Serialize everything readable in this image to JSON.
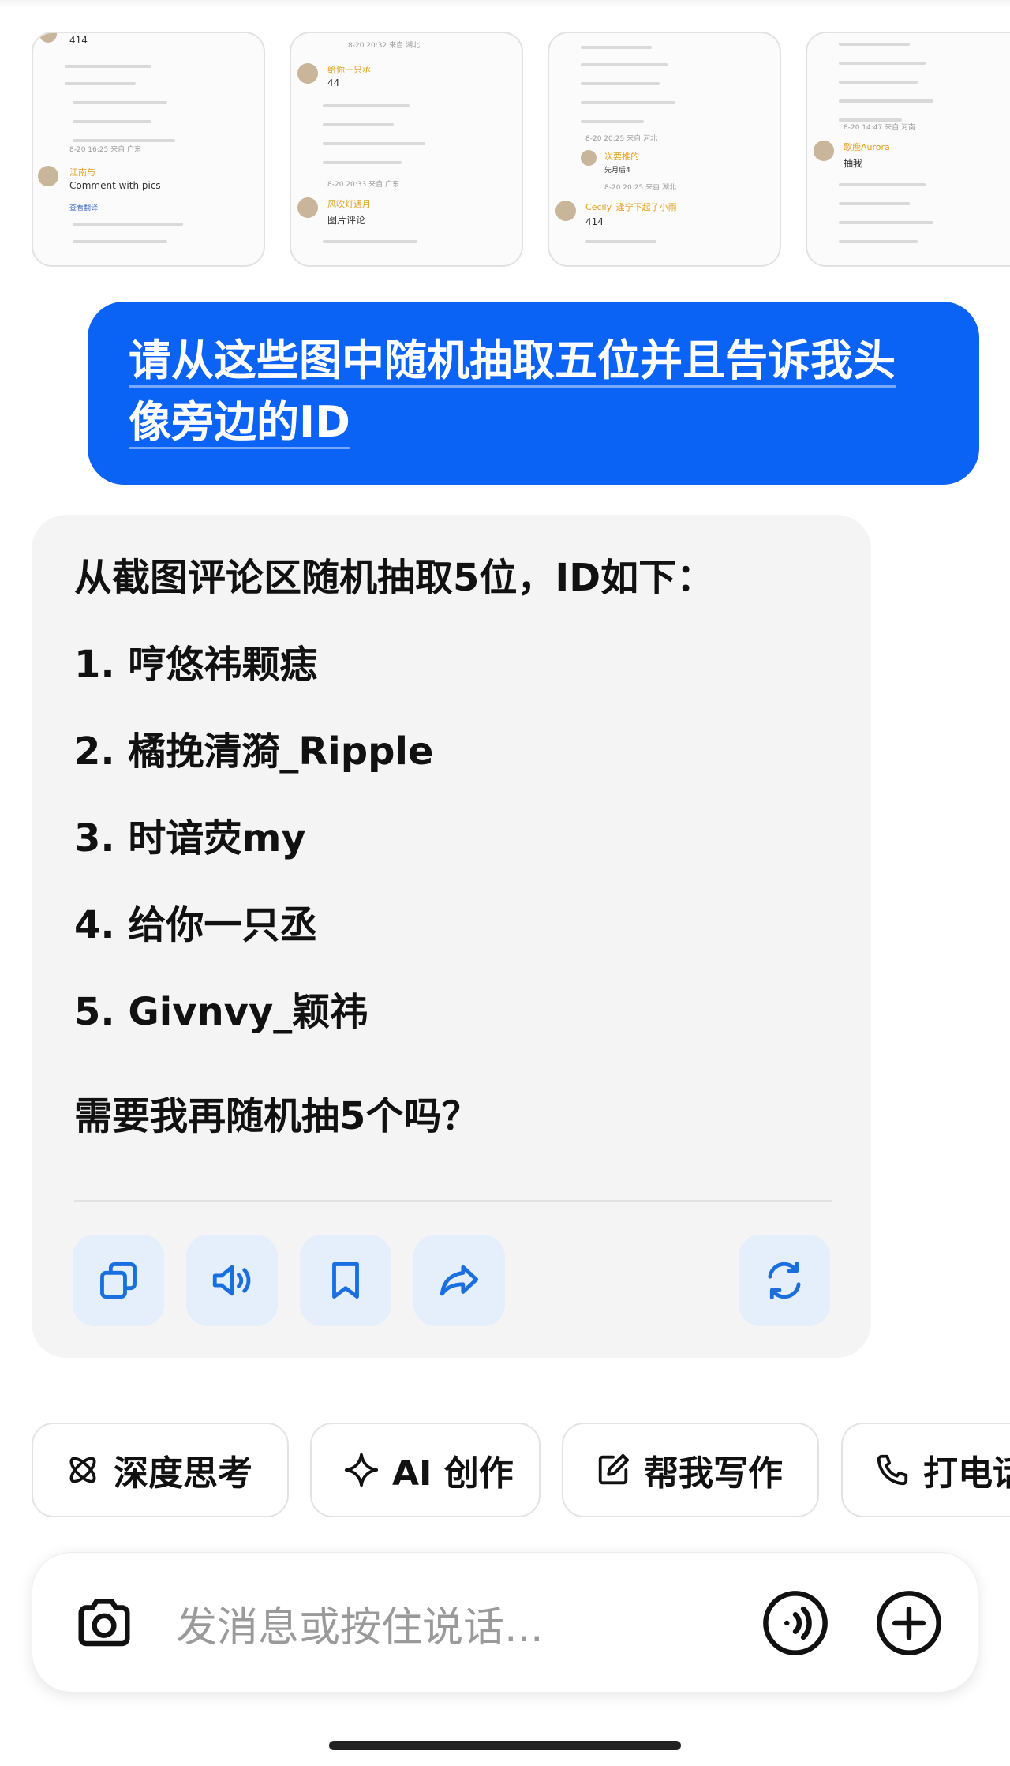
{
  "thumbnails": [
    {
      "count": "414",
      "time": "8-20 16:25 来自 广东",
      "name": "江南与",
      "text": "Comment with pics",
      "link": "查看翻译"
    },
    {
      "time": "8-20 20:32 来自 湖北",
      "name": "给你一只丞",
      "count": "44",
      "time2": "8-20 20:33 来自 广东",
      "name2": "风吹灯遇月",
      "text2": "图片评论"
    },
    {
      "time": "8-20 20:25 来自 河北",
      "name": "次要推的",
      "text": "先月后4",
      "time2": "8-20 20:25 来自 湖北",
      "name2": "Cecily_逢宁下起了小雨",
      "count": "414"
    },
    {
      "time": "8-20 14:47 来自 河南",
      "name": "歌鹿Aurora",
      "text": "抽我"
    }
  ],
  "user_message": {
    "line1": "请从这些图中随机抽取五位并且告诉我头",
    "line2": "像旁边的ID"
  },
  "assistant": {
    "intro": "从截图评论区随机抽取5位，ID如下：",
    "items": [
      "1. 哼悠祎颗痣",
      "2. 橘挽清漪_Ripple",
      "3. 时谙荧my",
      "4. 给你一只丞",
      "5. Givnvy_颖祎"
    ],
    "followup": "需要我再随机抽5个吗？"
  },
  "actions": {
    "copy": "copy-icon",
    "speak": "speaker-icon",
    "bookmark": "bookmark-icon",
    "share": "share-icon",
    "regenerate": "refresh-icon"
  },
  "chips": [
    {
      "label": "深度思考",
      "icon": "atom-icon"
    },
    {
      "label": "AI 创作",
      "icon": "sparkle-icon"
    },
    {
      "label": "帮我写作",
      "icon": "edit-icon"
    },
    {
      "label": "打电话",
      "icon": "phone-icon"
    }
  ],
  "input": {
    "placeholder": "发消息或按住说话..."
  },
  "colors": {
    "accent": "#0a63f5",
    "action_bg": "#e5eefb",
    "action_icon": "#1a6fe0",
    "bubble_bg": "#f4f4f5"
  }
}
